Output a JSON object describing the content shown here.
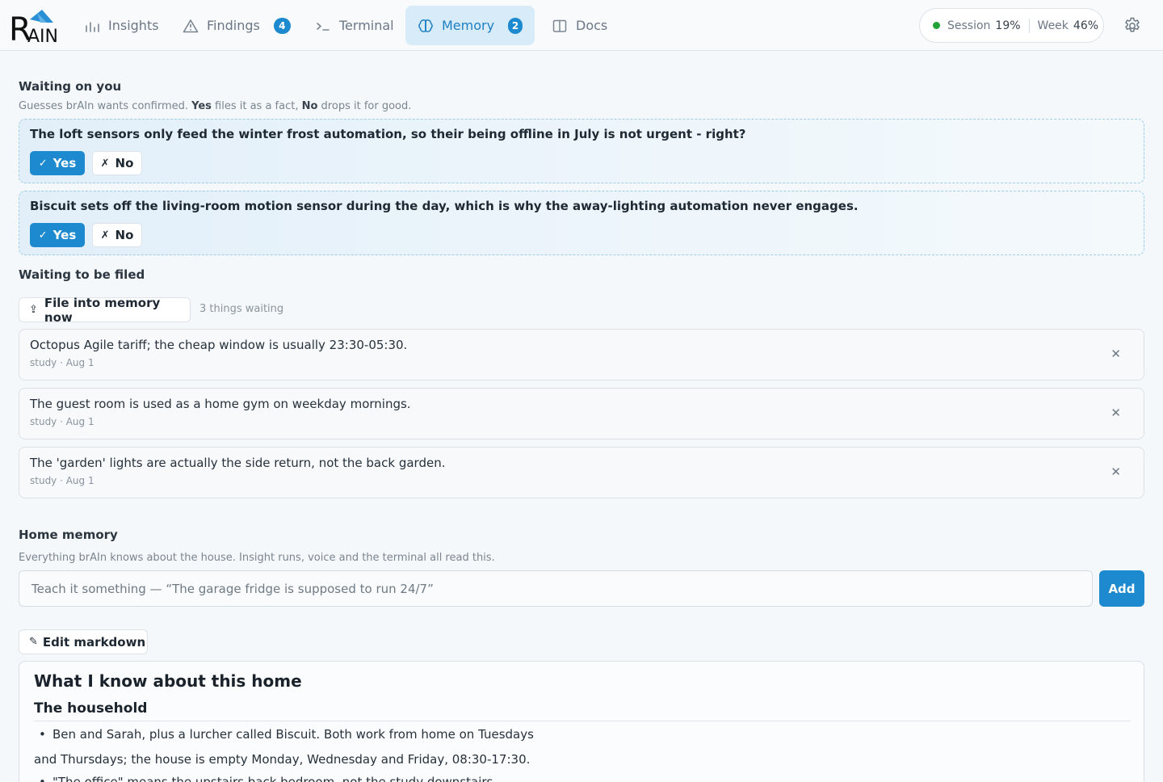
{
  "colors": {
    "accent": "#1d8ad0",
    "active_nav_bg": "#d7ecf8",
    "status_ok": "#22a33a"
  },
  "logo": {
    "text": "BRAIN",
    "icon": "brain-logo-icon"
  },
  "nav": {
    "insights": {
      "label": "Insights",
      "icon": "bar-chart-icon"
    },
    "findings": {
      "label": "Findings",
      "icon": "warning-triangle-icon",
      "badge": "4"
    },
    "terminal": {
      "label": "Terminal",
      "icon": "terminal-icon"
    },
    "memory": {
      "label": "Memory",
      "icon": "brain-icon",
      "badge": "2",
      "active": true
    },
    "docs": {
      "label": "Docs",
      "icon": "book-icon"
    }
  },
  "usage": {
    "session_label": "Session",
    "session_value": "19%",
    "week_label": "Week",
    "week_value": "46%"
  },
  "settings": {
    "icon": "gear-icon"
  },
  "waiting_on_you": {
    "title": "Waiting on you",
    "subtitle_pre": "Guesses brAIn wants confirmed. ",
    "subtitle_yes": "Yes",
    "subtitle_mid": " files it as a fact, ",
    "subtitle_no": "No",
    "subtitle_post": " drops it for good.",
    "items": [
      {
        "question": "The loft sensors only feed the winter frost automation, so their being offline in July is not urgent - right?",
        "yes_label": "Yes",
        "no_label": "No"
      },
      {
        "question": "Biscuit sets off the living-room motion sensor during the day, which is why the away-lighting automation never engages.",
        "yes_label": "Yes",
        "no_label": "No"
      }
    ]
  },
  "waiting_to_be_filed": {
    "title": "Waiting to be filed",
    "file_button": "File into memory now",
    "count_text": "3 things waiting",
    "items": [
      {
        "text": "Octopus Agile tariff; the cheap window is usually 23:30-05:30.",
        "meta": "study · Aug 1"
      },
      {
        "text": "The guest room is used as a home gym on weekday mornings.",
        "meta": "study · Aug 1"
      },
      {
        "text": "The 'garden' lights are actually the side return, not the back garden.",
        "meta": "study · Aug 1"
      }
    ]
  },
  "home_memory": {
    "title": "Home memory",
    "subtitle": "Everything brAIn knows about the house. Insight runs, voice and the terminal all read this.",
    "input_placeholder": "Teach it something — “The garage fridge is supposed to run 24/7”",
    "add_button": "Add",
    "edit_button": "Edit markdown",
    "doc": {
      "h1": "What I know about this home",
      "h2": "The household",
      "li1": "Ben and Sarah, plus a lurcher called Biscuit. Both work from home on Tuesdays",
      "p1": "and Thursdays; the house is empty Monday, Wednesday and Friday, 08:30-17:30.",
      "li2": "\"The office\" means the upstairs back bedroom, not the study downstairs."
    }
  }
}
